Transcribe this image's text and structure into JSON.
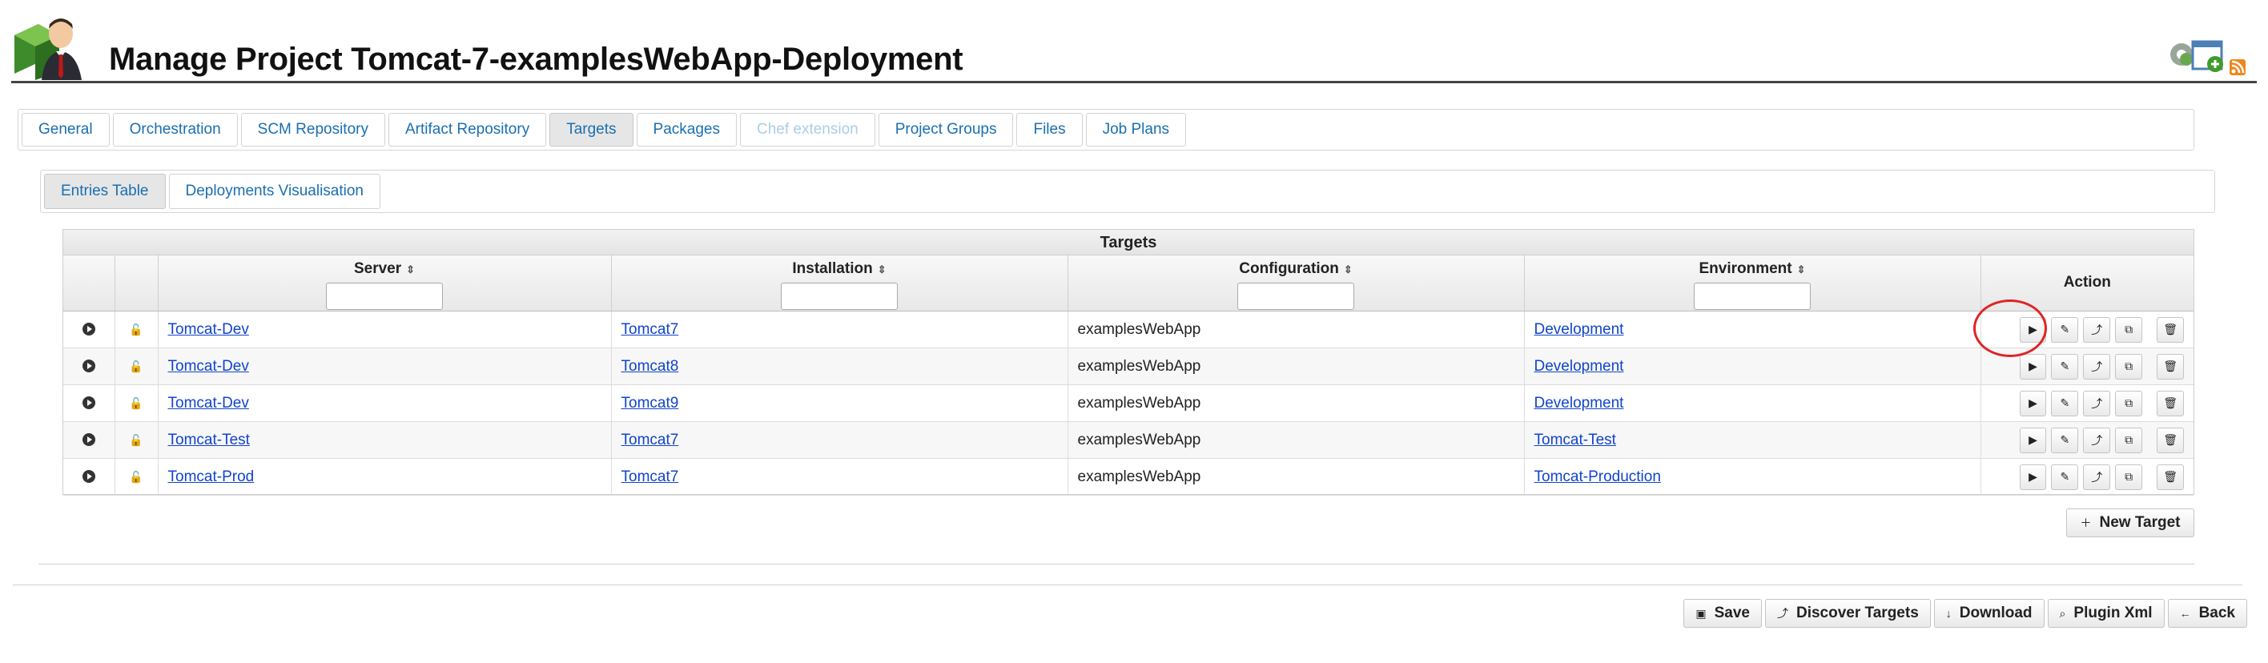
{
  "page": {
    "title": "Manage Project Tomcat-7-examplesWebApp-Deployment"
  },
  "tabs": [
    {
      "label": "General"
    },
    {
      "label": "Orchestration"
    },
    {
      "label": "SCM Repository"
    },
    {
      "label": "Artifact Repository"
    },
    {
      "label": "Targets"
    },
    {
      "label": "Packages"
    },
    {
      "label": "Chef extension"
    },
    {
      "label": "Project Groups"
    },
    {
      "label": "Files"
    },
    {
      "label": "Job Plans"
    }
  ],
  "subtabs": [
    {
      "label": "Entries Table"
    },
    {
      "label": "Deployments Visualisation"
    }
  ],
  "table": {
    "caption": "Targets",
    "headers": {
      "server": "Server",
      "installation": "Installation",
      "configuration": "Configuration",
      "environment": "Environment",
      "action": "Action"
    },
    "rows": [
      {
        "server": "Tomcat-Dev",
        "installation": "Tomcat7",
        "configuration": "examplesWebApp",
        "environment": "Development"
      },
      {
        "server": "Tomcat-Dev",
        "installation": "Tomcat8",
        "configuration": "examplesWebApp",
        "environment": "Development"
      },
      {
        "server": "Tomcat-Dev",
        "installation": "Tomcat9",
        "configuration": "examplesWebApp",
        "environment": "Development"
      },
      {
        "server": "Tomcat-Test",
        "installation": "Tomcat7",
        "configuration": "examplesWebApp",
        "environment": "Tomcat-Test"
      },
      {
        "server": "Tomcat-Prod",
        "installation": "Tomcat7",
        "configuration": "examplesWebApp",
        "environment": "Tomcat-Production"
      }
    ]
  },
  "buttons": {
    "new_target": "New Target",
    "save": "Save",
    "discover_targets": "Discover Targets",
    "download": "Download",
    "plugin_xml": "Plugin Xml",
    "back": "Back"
  },
  "colors": {
    "link": "#1144cc",
    "tab_text": "#1a6fb0",
    "highlight": "#e02424"
  }
}
